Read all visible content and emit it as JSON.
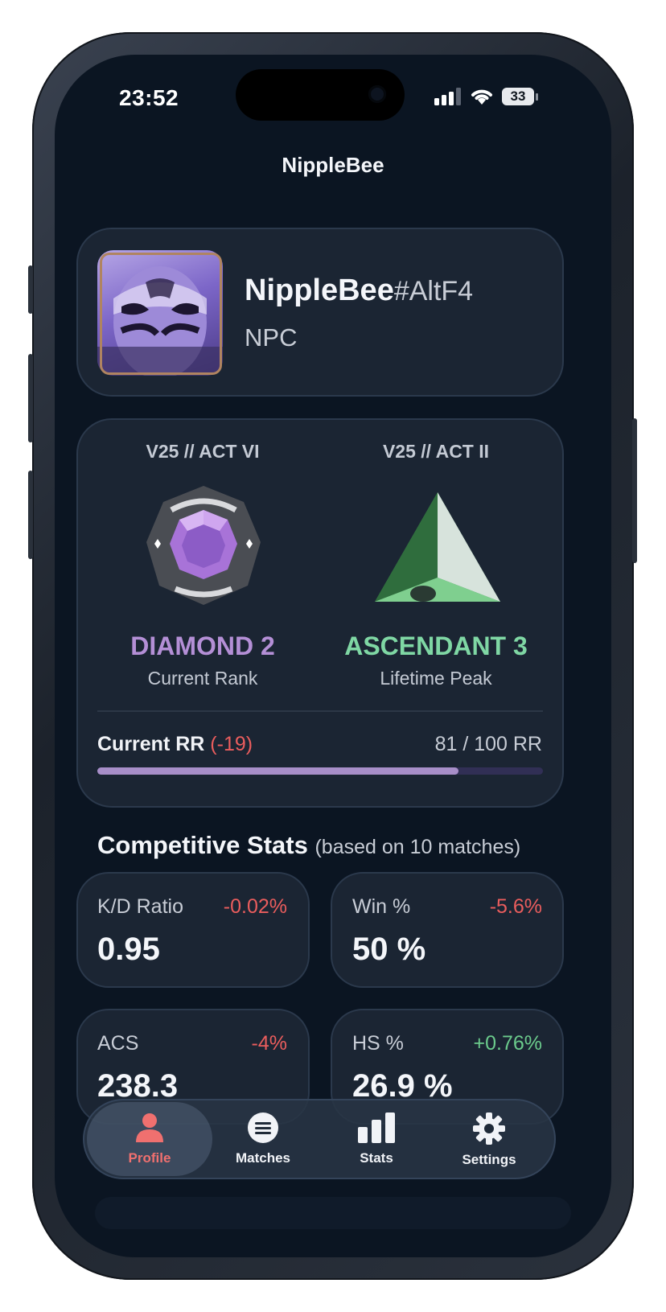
{
  "status_bar": {
    "time": "23:52",
    "battery": "33"
  },
  "page": {
    "title": "NippleBee"
  },
  "player": {
    "name": "NippleBee",
    "tag": "#AltF4",
    "title": "NPC"
  },
  "ranks": {
    "current": {
      "act": "V25 // ACT VI",
      "rank": "DIAMOND 2",
      "label": "Current Rank",
      "color": "#b48fd6"
    },
    "peak": {
      "act": "V25 // ACT II",
      "rank": "ASCENDANT 3",
      "label": "Lifetime Peak",
      "color": "#7fd7a4"
    }
  },
  "rr": {
    "label": "Current RR",
    "change": "(-19)",
    "value_text": "81 / 100 RR",
    "progress": 0.81
  },
  "stats_section": {
    "title": "Competitive Stats",
    "subtitle": "(based on 10 matches)"
  },
  "stats": [
    {
      "label": "K/D Ratio",
      "change": "-0.02%",
      "value": "0.95",
      "trend": "down"
    },
    {
      "label": "Win %",
      "change": "-5.6%",
      "value": "50 %",
      "trend": "down"
    },
    {
      "label": "ACS",
      "change": "-4%",
      "value": "238.3",
      "trend": "down"
    },
    {
      "label": "HS %",
      "change": "+0.76%",
      "value": "26.9 %",
      "trend": "up"
    }
  ],
  "tabbar": {
    "items": [
      {
        "label": "Profile",
        "icon": "person-icon",
        "active": true
      },
      {
        "label": "Matches",
        "icon": "list-icon",
        "active": false
      },
      {
        "label": "Stats",
        "icon": "bar-chart-icon",
        "active": false
      },
      {
        "label": "Settings",
        "icon": "gear-icon",
        "active": false
      }
    ]
  },
  "colors": {
    "accent_active_tab": "#f0706f",
    "negative": "#ea5d5d",
    "positive": "#6bcb8c"
  }
}
